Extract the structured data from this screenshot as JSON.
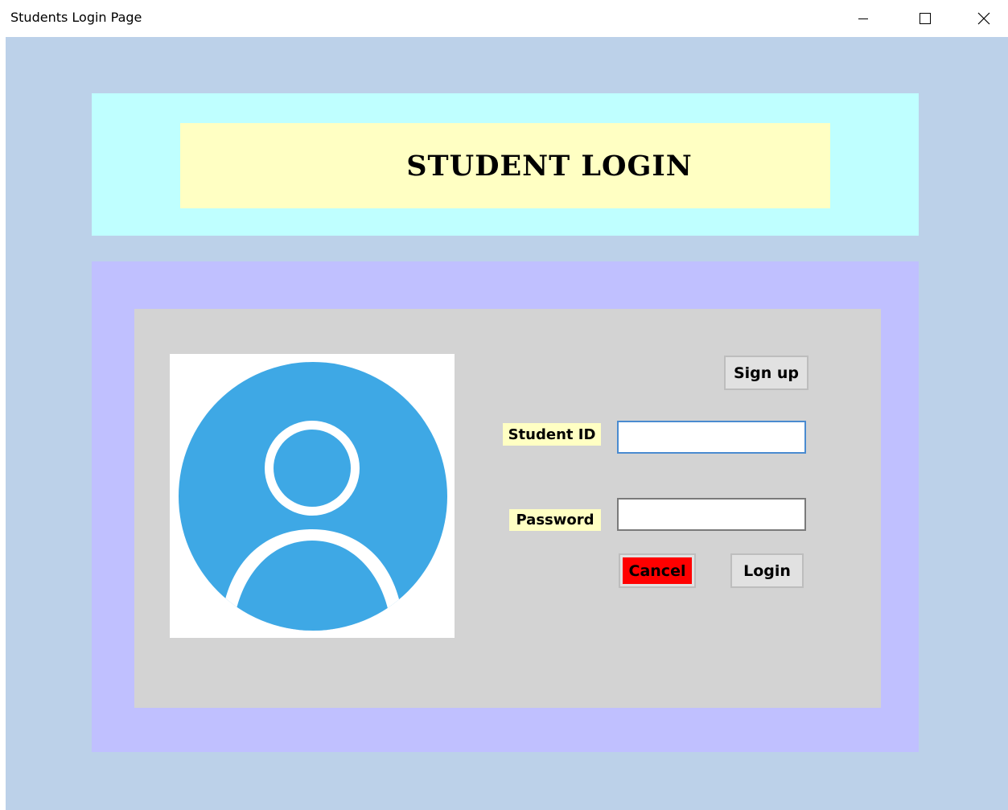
{
  "window": {
    "title": "Students Login Page",
    "controls": {
      "minimize_icon": "minimize-icon",
      "maximize_icon": "maximize-icon",
      "close_icon": "close-icon"
    }
  },
  "header": {
    "heading": "STUDENT LOGIN"
  },
  "form": {
    "signup_label": "Sign up",
    "student_id_label": "Student ID",
    "student_id_value": "",
    "password_label": "Password",
    "password_value": "",
    "cancel_label": "Cancel",
    "login_label": "Login"
  },
  "avatar": {
    "icon": "user-avatar-icon"
  },
  "colors": {
    "client_bg": "#bcd1e9",
    "header_panel": "#bfffff",
    "title_panel": "#ffffc3",
    "outer_panel": "#c0c0ff",
    "inner_panel": "#d3d3d3",
    "avatar_blue": "#3ea8e5",
    "label_bg": "#ffffc3",
    "cancel_bg": "#ff0000",
    "focus_border": "#4a8bd0"
  }
}
